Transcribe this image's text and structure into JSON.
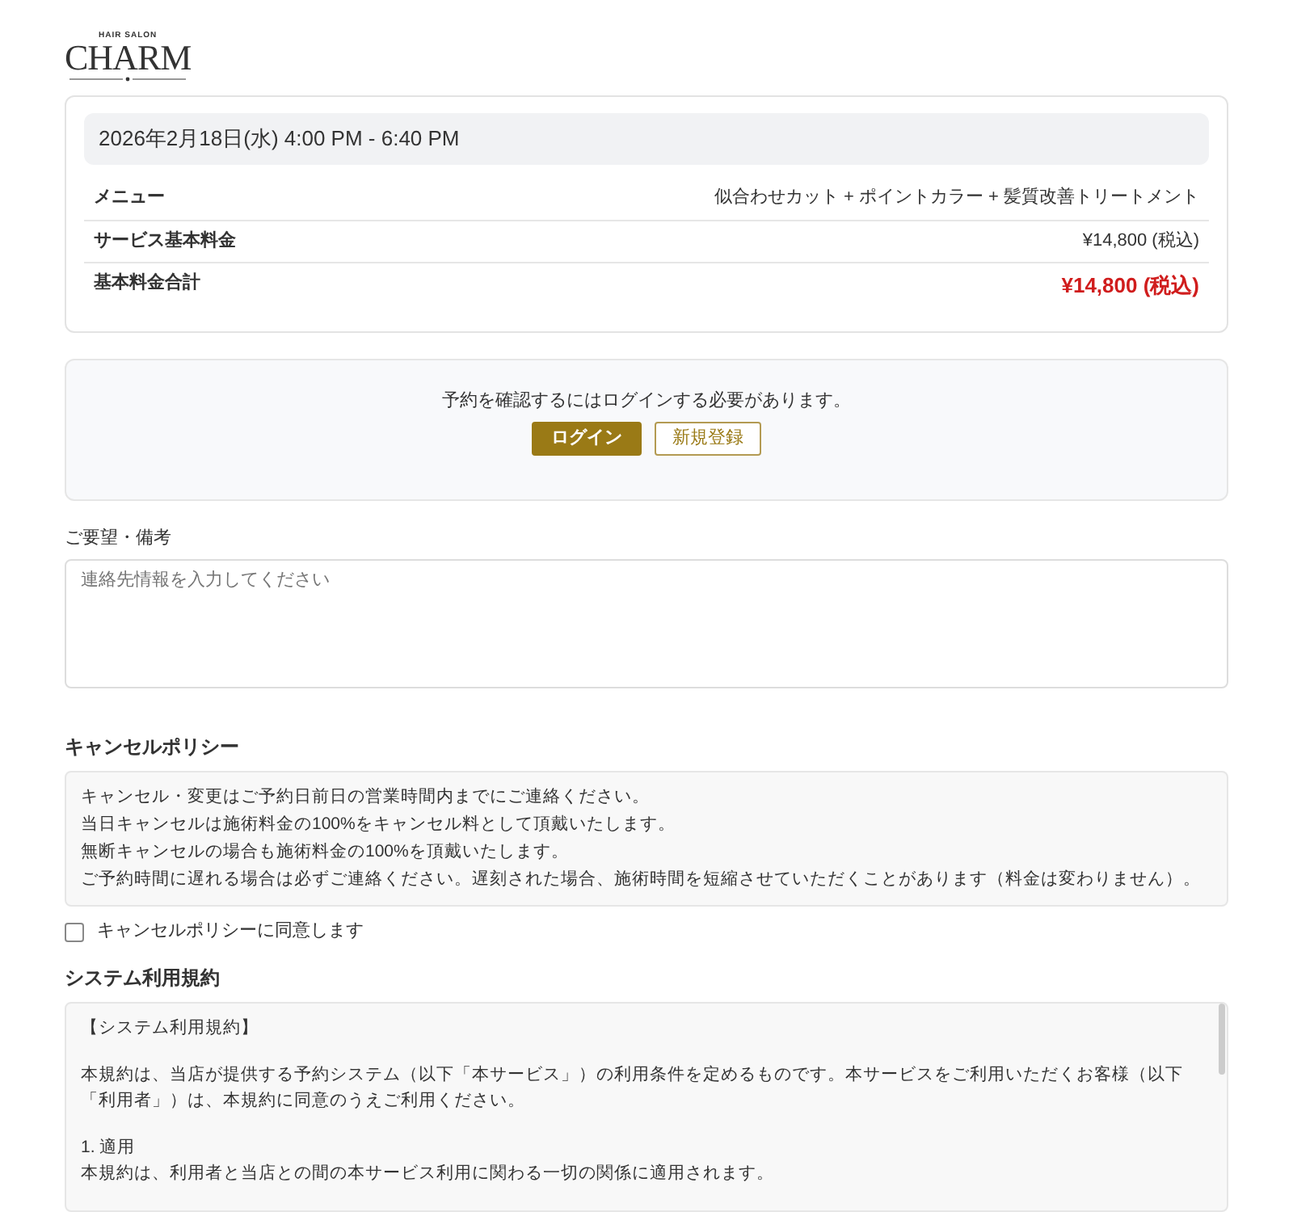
{
  "logo": {
    "tagline": "HAIR SALON",
    "name": "CHARM"
  },
  "booking": {
    "datetime": "2026年2月18日(水) 4:00 PM - 6:40 PM",
    "rows": [
      {
        "kind": "plain",
        "label": "メニュー",
        "value": "似合わせカット + ポイントカラー + 髪質改善トリートメント"
      },
      {
        "kind": "plain",
        "label": "サービス基本料金",
        "value": "¥14,800 (税込)"
      },
      {
        "kind": "total",
        "label": "基本料金合計",
        "value": "¥14,800 (税込)"
      }
    ]
  },
  "login_notice": {
    "message": "予約を確認するにはログインする必要があります。",
    "buttons": [
      {
        "kind": "primary",
        "label": "ログイン"
      },
      {
        "kind": "outline",
        "label": "新規登録"
      }
    ]
  },
  "notes": {
    "label": "ご要望・備考",
    "placeholder": "連絡先情報を入力してください"
  },
  "cancel_policy": {
    "heading": "キャンセルポリシー",
    "lines": [
      "キャンセル・変更はご予約日前日の営業時間内までにご連絡ください。",
      "当日キャンセルは施術料金の100%をキャンセル料として頂戴いたします。",
      "無断キャンセルの場合も施術料金の100%を頂戴いたします。",
      "ご予約時間に遅れる場合は必ずご連絡ください。遅刻された場合、施術時間を短縮させていただくことがあります（料金は変わりません）。"
    ],
    "agree": {
      "label": "キャンセルポリシーに同意します",
      "checked": false
    }
  },
  "terms": {
    "heading": "システム利用規約",
    "paragraphs": [
      [
        "【システム利用規約】"
      ],
      [
        "本規約は、当店が提供する予約システム（以下「本サービス」）の利用条件を定めるものです。本サービスをご利用いただくお客様（以下「利用者」）は、本規約に同意のうえご利用ください。"
      ],
      [
        "1. 適用",
        "本規約は、利用者と当店との間の本サービス利用に関わる一切の関係に適用されます。"
      ]
    ]
  }
}
